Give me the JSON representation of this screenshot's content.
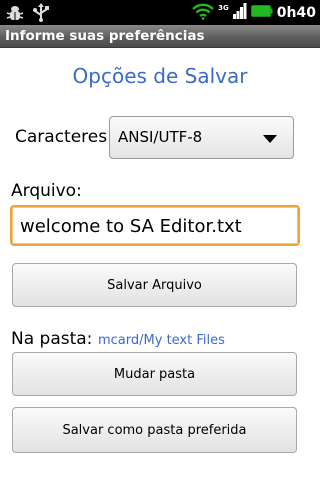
{
  "status_bar": {
    "notifications": [
      "bug-icon",
      "usb-icon"
    ],
    "network": "3G",
    "time": "0h40"
  },
  "title_bar": {
    "title": "Informe suas preferências"
  },
  "heading": "Opções de Salvar",
  "charset": {
    "label": "Caracteres:",
    "selected": "ANSI/UTF-8"
  },
  "file": {
    "label": "Arquivo:",
    "value": "welcome to SA Editor.txt"
  },
  "save_button": "Salvar Arquivo",
  "folder": {
    "label": "Na pasta:",
    "path": "mcard/My text Files"
  },
  "change_folder_button": "Mudar pasta",
  "save_preferred_button": "Salvar como pasta preferida",
  "colors": {
    "accent": "#3a6bc7",
    "focus": "#f0a23a",
    "battery": "#22b822"
  }
}
